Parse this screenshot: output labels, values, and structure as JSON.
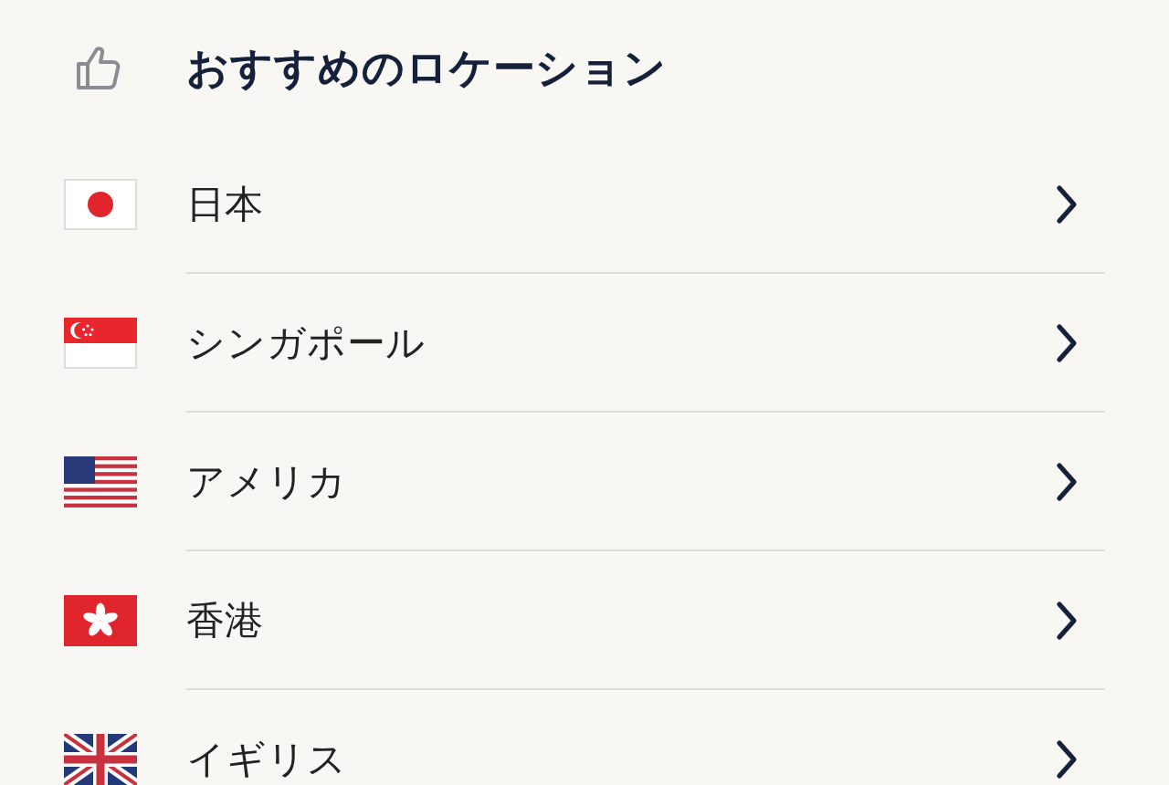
{
  "section": {
    "title": "おすすめのロケーション"
  },
  "locations": [
    {
      "name": "日本",
      "kind": "jp"
    },
    {
      "name": "シンガポール",
      "kind": "sg"
    },
    {
      "name": "アメリカ",
      "kind": "us"
    },
    {
      "name": "香港",
      "kind": "hk"
    },
    {
      "name": "イギリス",
      "kind": "gb"
    }
  ]
}
